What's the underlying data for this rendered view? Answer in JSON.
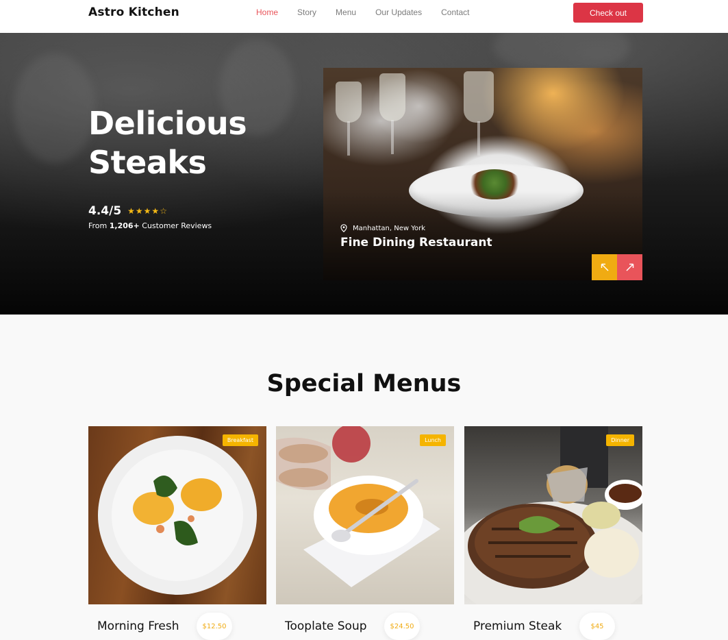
{
  "nav": {
    "brand": "Astro Kitchen",
    "links": [
      {
        "label": "Home",
        "active": true
      },
      {
        "label": "Story",
        "active": false
      },
      {
        "label": "Menu",
        "active": false
      },
      {
        "label": "Our Updates",
        "active": false
      },
      {
        "label": "Contact",
        "active": false
      }
    ],
    "cta_label": "Check out"
  },
  "hero": {
    "title_line1": "Delicious",
    "title_line2": "Steaks",
    "rating": "4.4/5",
    "stars": "★★★★☆",
    "stars_value": 4,
    "stars_max": 5,
    "reviews_prefix": "From ",
    "reviews_count": "1,206+",
    "reviews_suffix": " Customer Reviews",
    "card": {
      "location": "Manhattan, New York",
      "title": "Fine Dining Restaurant",
      "prev_icon": "arrow-up-left-icon",
      "next_icon": "arrow-up-right-icon"
    }
  },
  "specials": {
    "title": "Special Menus",
    "items": [
      {
        "badge": "Breakfast",
        "name": "Morning Fresh",
        "price": "$12.50"
      },
      {
        "badge": "Lunch",
        "name": "Tooplate Soup",
        "price": "$24.50"
      },
      {
        "badge": "Dinner",
        "name": "Premium Steak",
        "price": "$45"
      }
    ]
  },
  "colors": {
    "accent_red": "#dc3545",
    "active_link": "#e9545a",
    "gold": "#f0ab12",
    "badge": "#f5b400"
  }
}
